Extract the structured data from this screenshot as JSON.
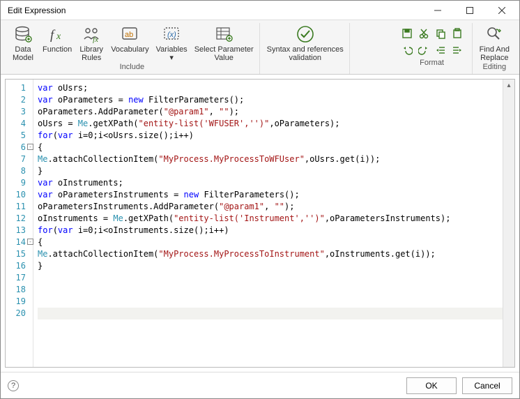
{
  "window": {
    "title": "Edit Expression"
  },
  "ribbon": {
    "include": {
      "data_model": "Data\nModel",
      "function": "Function",
      "library_rules": "Library\nRules",
      "vocabulary": "Vocabulary",
      "variables": "Variables\n▾",
      "select_param": "Select Parameter\nValue",
      "group_label": "Include"
    },
    "validate": {
      "syntax": "Syntax and references\nvalidation"
    },
    "format": {
      "group_label": "Format"
    },
    "editing": {
      "find_replace": "Find And\nReplace",
      "group_label": "Editing"
    }
  },
  "code": {
    "lines": [
      [
        [
          "k",
          "var"
        ],
        [
          "p",
          " oUsrs;"
        ]
      ],
      [
        [
          "k",
          "var"
        ],
        [
          "p",
          " oParameters = "
        ],
        [
          "k",
          "new"
        ],
        [
          "p",
          " FilterParameters();"
        ]
      ],
      [
        [
          "p",
          "oParameters.AddParameter("
        ],
        [
          "s",
          "\"@param1\""
        ],
        [
          "p",
          ", "
        ],
        [
          "s",
          "\"\""
        ],
        [
          "p",
          ");"
        ]
      ],
      [
        [
          "p",
          "oUsrs = "
        ],
        [
          "teal",
          "Me"
        ],
        [
          "p",
          ".getXPath("
        ],
        [
          "s",
          "\"entity-list('WFUSER','')\""
        ],
        [
          "p",
          ",oParameters);"
        ]
      ],
      [
        [
          "k",
          "for"
        ],
        [
          "p",
          "("
        ],
        [
          "k",
          "var"
        ],
        [
          "p",
          " i=0;i<oUsrs.size();i++)"
        ]
      ],
      [
        [
          "p",
          "{"
        ]
      ],
      [
        [
          "teal",
          "Me"
        ],
        [
          "p",
          ".attachCollectionItem("
        ],
        [
          "s",
          "\"MyProcess.MyProcessToWFUser\""
        ],
        [
          "p",
          ",oUsrs.get(i));"
        ]
      ],
      [
        [
          "p",
          "}"
        ]
      ],
      [
        [
          "k",
          "var"
        ],
        [
          "p",
          " oInstruments;"
        ]
      ],
      [
        [
          "k",
          "var"
        ],
        [
          "p",
          " oParametersInstruments = "
        ],
        [
          "k",
          "new"
        ],
        [
          "p",
          " FilterParameters();"
        ]
      ],
      [
        [
          "p",
          "oParametersInstruments.AddParameter("
        ],
        [
          "s",
          "\"@param1\""
        ],
        [
          "p",
          ", "
        ],
        [
          "s",
          "\"\""
        ],
        [
          "p",
          ");"
        ]
      ],
      [
        [
          "p",
          "oInstruments = "
        ],
        [
          "teal",
          "Me"
        ],
        [
          "p",
          ".getXPath("
        ],
        [
          "s",
          "\"entity-list('Instrument','')\""
        ],
        [
          "p",
          ",oParametersInstruments);"
        ]
      ],
      [
        [
          "k",
          "for"
        ],
        [
          "p",
          "("
        ],
        [
          "k",
          "var"
        ],
        [
          "p",
          " i=0;i<oInstruments.size();i++)"
        ]
      ],
      [
        [
          "p",
          "{"
        ]
      ],
      [
        [
          "teal",
          "Me"
        ],
        [
          "p",
          ".attachCollectionItem("
        ],
        [
          "s",
          "\"MyProcess.MyProcessToInstrument\""
        ],
        [
          "p",
          ",oInstruments.get(i));"
        ]
      ],
      [
        [
          "p",
          "}"
        ]
      ],
      [],
      [],
      [],
      []
    ],
    "fold_lines": [
      6,
      14
    ],
    "highlight_line": 20
  },
  "footer": {
    "ok": "OK",
    "cancel": "Cancel"
  }
}
